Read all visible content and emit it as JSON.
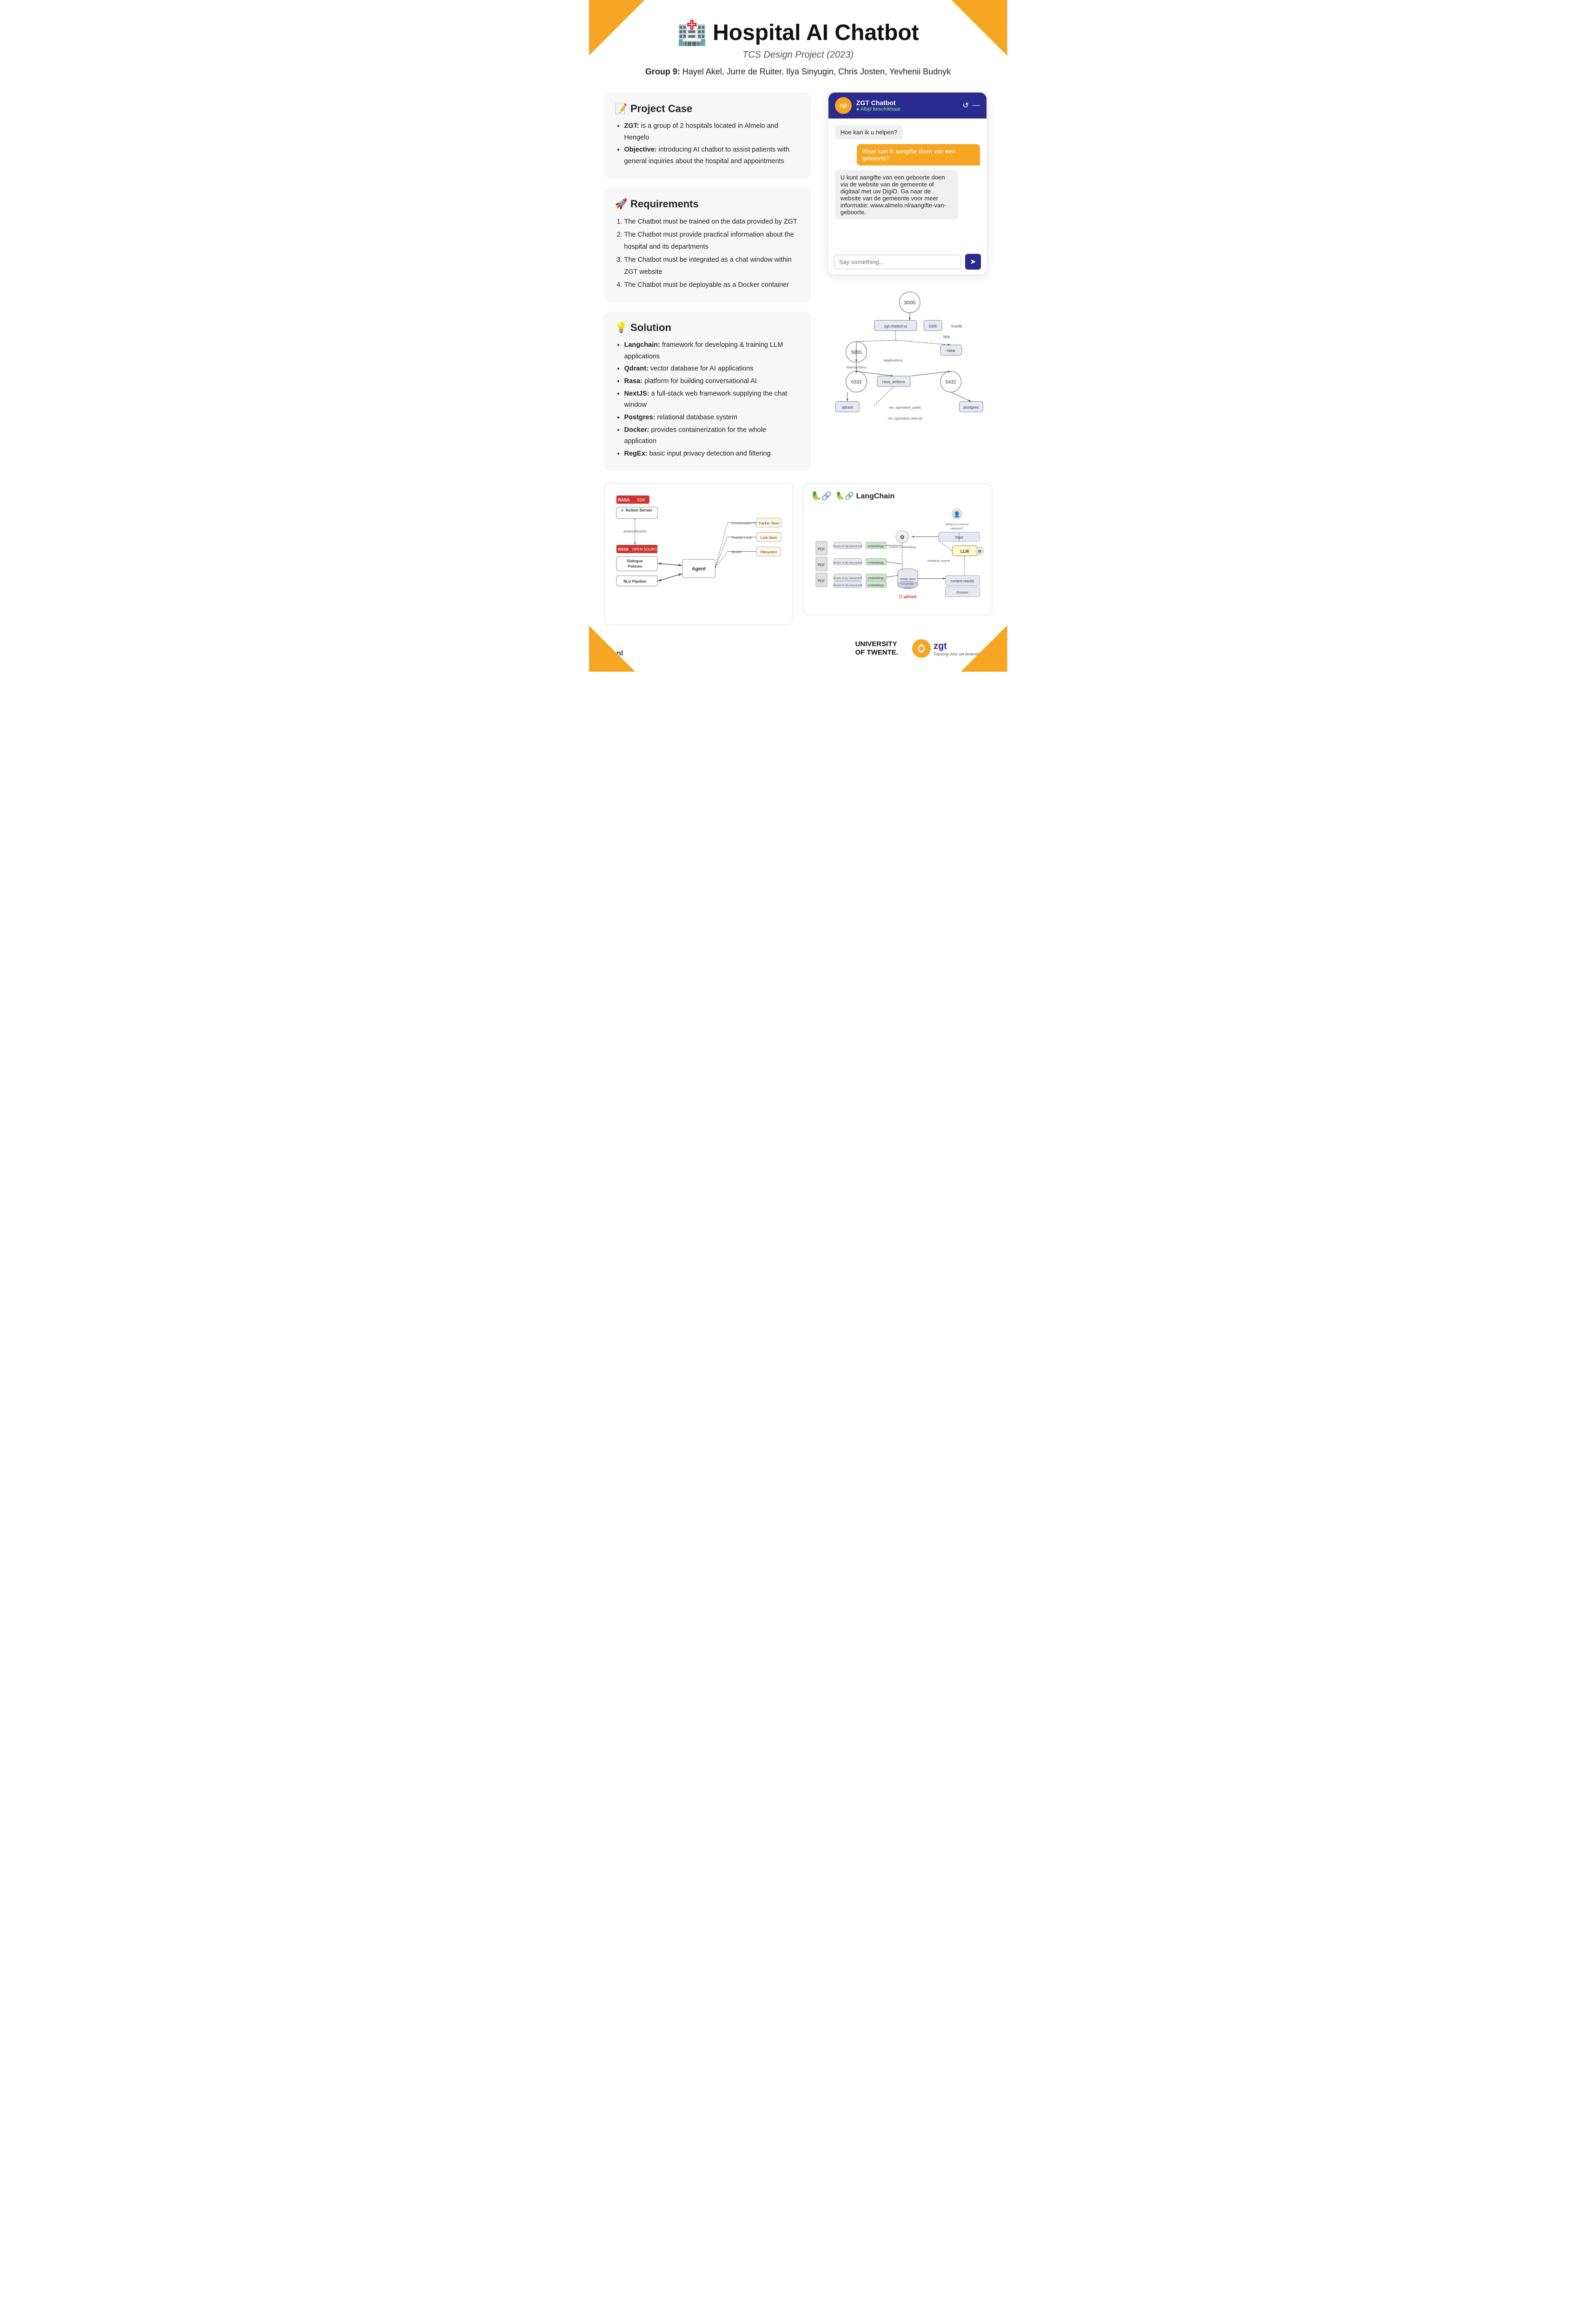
{
  "corners": {
    "decoration": "orange-triangle"
  },
  "header": {
    "icon": "🏥",
    "title": "Hospital AI Chatbot",
    "subtitle": "TCS Design Project (2023)",
    "group_label": "Group 9:",
    "group_members": "Hayel Akel, Jurre de Ruiter, Ilya Sinyugin, Chris Josten, Yevhenii Budnyk"
  },
  "project_case": {
    "title": "📝 Project Case",
    "bullets": [
      {
        "bold": "ZGT:",
        "rest": " is a group of 2 hospitals located in Almelo and Hengelo"
      },
      {
        "bold": "Objective:",
        "rest": " introducing AI chatbot to assist patients with general inquiries about the hospital and appointments"
      }
    ]
  },
  "requirements": {
    "title": "🚀 Requirements",
    "items": [
      "The Chatbot must be trained on the data provided by ZGT",
      "The Chatbot must provide practical information about the hospital and its departments",
      "The Chatbot must be integrated as a chat window within ZGT website",
      "The Chatbot must be deployable as a Docker container"
    ]
  },
  "solution": {
    "title": "💡 Solution",
    "bullets": [
      {
        "bold": "Langchain:",
        "rest": " framework for developing & training LLM applications"
      },
      {
        "bold": "Qdrant:",
        "rest": " vector database for AI applications"
      },
      {
        "bold": "Rasa:",
        "rest": " platform for building conversational AI"
      },
      {
        "bold": "NextJS:",
        "rest": " a full-stack web framework supplying the chat window"
      },
      {
        "bold": "Postgres:",
        "rest": " relational database system"
      },
      {
        "bold": "Docker:",
        "rest": " provides containerization for the whole application"
      },
      {
        "bold": "RegEx:",
        "rest": " basic input privacy detection and filtering"
      }
    ]
  },
  "chatbot": {
    "header_name": "ZGT Chatbot",
    "header_status": "● Altijd beschikbaar",
    "messages": [
      {
        "type": "bot",
        "text": "Hoe kan ik u helpen?"
      },
      {
        "type": "user",
        "text": "Waar kan ik aangifte doen van een geboorte?"
      },
      {
        "type": "bot",
        "text": "U kunt aangifte van een geboorte doen via de website van de gemeente of digitaal met uw DigiD. Ga naar de website van de gemeente voor meer informatie: www.almelo.nl/aangifte-van-geboorte."
      }
    ],
    "input_placeholder": "Say something...",
    "send_button_icon": "➤"
  },
  "rasa_diagram": {
    "sdk_label": "RASA SDK",
    "action_server_label": "Action Server",
    "actions_events_label": "Actions/Events",
    "open_source_label": "RASA OPEN SOURCE",
    "dialogue_policies_label": "Dialogue Policies",
    "nlu_pipeline_label": "NLU Pipeline",
    "agent_label": "Agent",
    "tracker_store_label": "Tracker Store",
    "lock_store_label": "Lock Store",
    "filesystem_label": "Filesystem",
    "conversation_tracker_label": "Conversation Tracker",
    "tracker_lock_label": "Tracker Lock",
    "model_label": "Model"
  },
  "langchain": {
    "title": "🦜🔗 LangChain",
    "description": "LangChain architecture diagram"
  },
  "footer": {
    "website": "zgt.nl",
    "ut_line1": "UNIVERSITY",
    "ut_line2": "OF TWENTE.",
    "zgt_tagline": "Topzorg voor uw levenskwaliteit"
  },
  "colors": {
    "primary_blue": "#2B2B8F",
    "orange": "#F5A623",
    "light_bg": "#f7f7f7",
    "rasa_red": "#CC3333"
  }
}
